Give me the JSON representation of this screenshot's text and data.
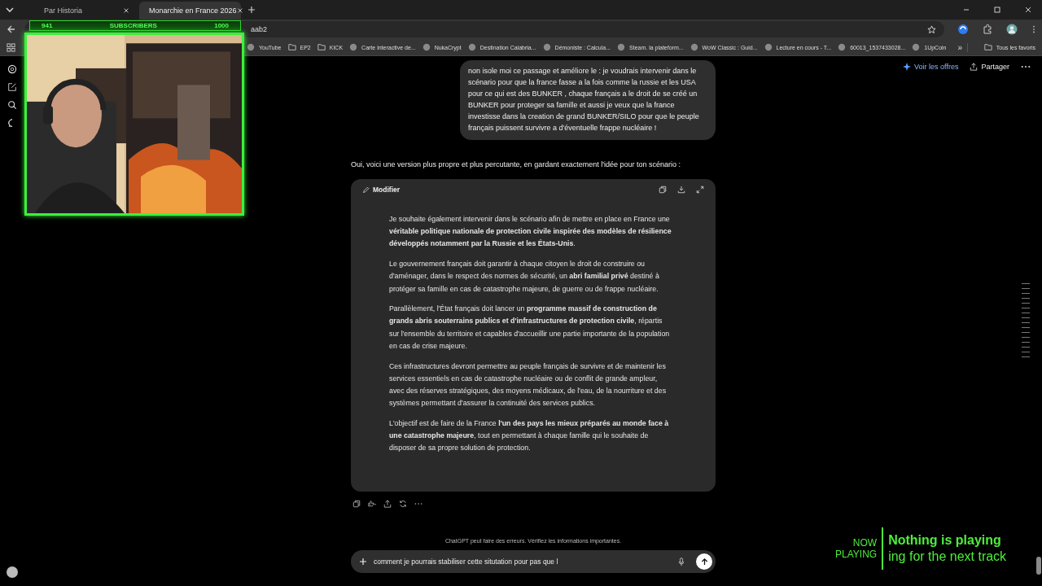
{
  "browser": {
    "tabs": [
      {
        "title": "Par Historia",
        "selected": false
      },
      {
        "title": "Monarchie en France 2026",
        "selected": true
      }
    ],
    "address": "aab2",
    "bookmarks": [
      {
        "label": "YouTube",
        "kind": "site"
      },
      {
        "label": "EP2",
        "kind": "folder"
      },
      {
        "label": "KICK",
        "kind": "folder"
      },
      {
        "label": "Carte interactive de...",
        "kind": "site"
      },
      {
        "label": "NukaCrypt",
        "kind": "site"
      },
      {
        "label": "Destination Calabria...",
        "kind": "site"
      },
      {
        "label": "Démoniste : Calcula...",
        "kind": "site"
      },
      {
        "label": "Steam. la plateform...",
        "kind": "site"
      },
      {
        "label": "WoW Classic : Guid...",
        "kind": "site"
      },
      {
        "label": "Lecture en cours - T...",
        "kind": "site"
      },
      {
        "label": "60013_1537433028...",
        "kind": "site"
      },
      {
        "label": "1UpCoin",
        "kind": "site"
      }
    ],
    "more_bookmarks": "»",
    "all_bookmarks": "Tous les favoris"
  },
  "stream_overlay": {
    "current": "941",
    "label": "SUBSCRIBERS",
    "target": "1000"
  },
  "now_playing": {
    "label": [
      "NOW",
      "PLAYING"
    ],
    "title": "Nothing is playing",
    "subtitle": "ing for the next track"
  },
  "chat": {
    "header_actions": [
      "Voir les offres",
      "Partager"
    ],
    "user_message": "non isole moi ce passage et améliore le : je voudrais intervenir dans le scénario pour que la france fasse a la fois comme la russie et les USA pour ce qui est des BUNKER , chaque français a le droit de se créé un BUNKER pour proteger sa famille et aussi je veux que la france investisse dans la creation de grand BUNKER/SILO pour que le peuple français puissent survivre a d'éventuelle frappe nucléaire !",
    "assistant_intro": "Oui, voici une version plus propre et plus percutante, en gardant exactement l'idée pour ton scénario :",
    "canvas": {
      "edit_label": "Modifier",
      "paragraphs": [
        "Je souhaite également intervenir dans le scénario afin de mettre en place en France une **véritable politique nationale de protection civile inspirée des modèles de résilience développés notamment par la Russie et les États-Unis**.",
        "Le gouvernement français doit garantir à chaque citoyen le droit de construire ou d'aménager, dans le respect des normes de sécurité, un **abri familial privé** destiné à protéger sa famille en cas de catastrophe majeure, de guerre ou de frappe nucléaire.",
        "Parallèlement, l'État français doit lancer un **programme massif de construction de grands abris souterrains publics et d'infrastructures de protection civile**, répartis sur l'ensemble du territoire et capables d'accueillir une partie importante de la population en cas de crise majeure.",
        "Ces infrastructures devront permettre au peuple français de survivre et de maintenir les services essentiels en cas de catastrophe nucléaire ou de conflit de grande ampleur, avec des réserves stratégiques, des moyens médicaux, de l'eau, de la nourriture et des systèmes permettant d'assurer la continuité des services publics.",
        "L'objectif est de faire de la France **l'un des pays les mieux préparés au monde face à une catastrophe majeure**, tout en permettant à chaque famille qui le souhaite de disposer de sa propre solution de protection."
      ]
    },
    "disclaimer": "ChatGPT peut faire des erreurs. Vérifiez les informations importantes.",
    "composer": {
      "value": "comment je pourrais stabiliser cette situtation pour pas que l"
    }
  }
}
